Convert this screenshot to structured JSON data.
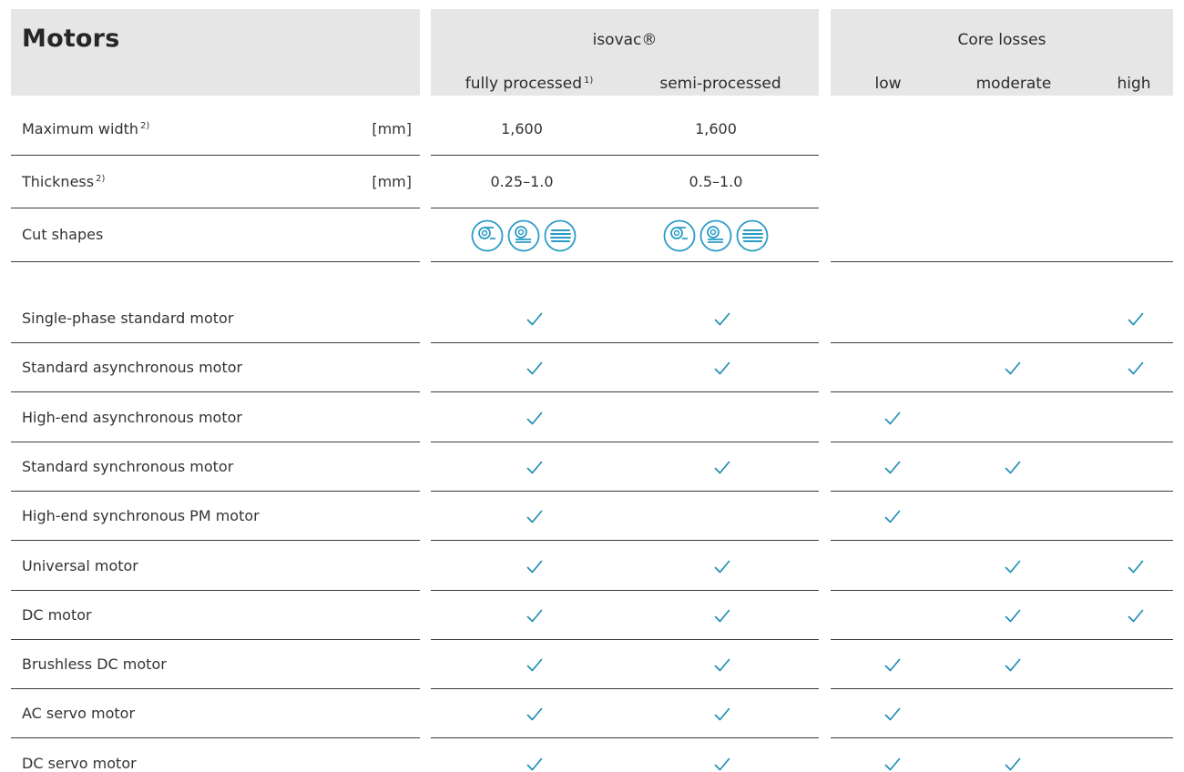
{
  "header": {
    "title": "Motors",
    "isovac_label": "isovac®",
    "core_losses_label": "Core losses",
    "col_fully": "fully processed",
    "col_fully_note": "1)",
    "col_semi": "semi-processed",
    "col_low": "low",
    "col_moderate": "moderate",
    "col_high": "high"
  },
  "specs": [
    {
      "label": "Maximum width",
      "note": "2)",
      "unit": "[mm]",
      "fully": "1,600",
      "semi": "1,600"
    },
    {
      "label": "Thickness",
      "note": "2)",
      "unit": "[mm]",
      "fully": "0.25–1.0",
      "semi": "0.5–1.0"
    },
    {
      "label": "Cut shapes",
      "note": "",
      "unit": "",
      "fully": "",
      "semi": ""
    }
  ],
  "cut_shape_icons": [
    "coil-icon",
    "slit-coil-icon",
    "sheet-stack-icon"
  ],
  "motors": [
    {
      "label": "Single-phase standard motor",
      "checks": [
        true,
        true,
        false,
        false,
        true
      ]
    },
    {
      "label": "Standard asynchronous motor",
      "checks": [
        true,
        true,
        false,
        true,
        true
      ]
    },
    {
      "label": "High-end asynchronous motor",
      "checks": [
        true,
        false,
        true,
        false,
        false
      ]
    },
    {
      "label": "Standard synchronous motor",
      "checks": [
        true,
        true,
        true,
        true,
        false
      ]
    },
    {
      "label": "High-end synchronous PM motor",
      "checks": [
        true,
        false,
        true,
        false,
        false
      ]
    },
    {
      "label": "Universal motor",
      "checks": [
        true,
        true,
        false,
        true,
        true
      ]
    },
    {
      "label": "DC motor",
      "checks": [
        true,
        true,
        false,
        true,
        true
      ]
    },
    {
      "label": "Brushless DC motor",
      "checks": [
        true,
        true,
        true,
        true,
        false
      ]
    },
    {
      "label": "AC servo motor",
      "checks": [
        true,
        true,
        true,
        false,
        false
      ]
    },
    {
      "label": "DC servo motor",
      "checks": [
        true,
        true,
        true,
        true,
        false
      ]
    }
  ],
  "colors": {
    "check": "#1f8fb5",
    "icon": "#2a9cc4",
    "header_bg": "#e6e6e6"
  }
}
